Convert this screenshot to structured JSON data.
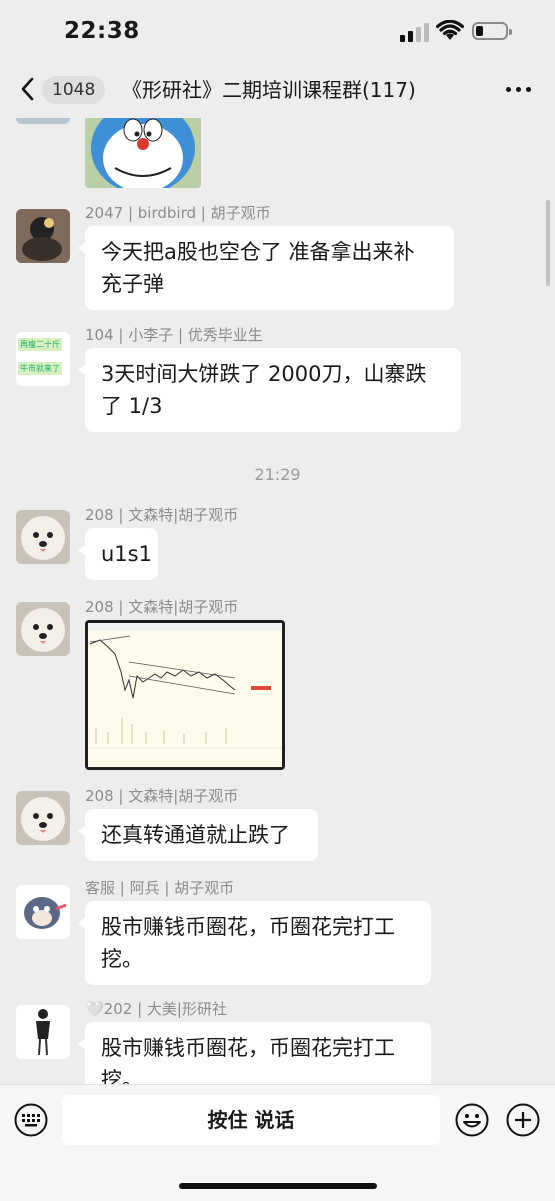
{
  "status_bar": {
    "time": "22:38"
  },
  "nav": {
    "unread_count": "1048",
    "title": "《形研社》二期培训课程群(117)"
  },
  "messages": [
    {
      "name": "2047 | birdbird | 胡子观币",
      "text": "今天把a股也空仓了 准备拿出来补充子弹",
      "line1": "今天把a股也空仓了 准备拿出来补",
      "line2": "充子弹"
    },
    {
      "name": "104 | 小李子 | 优秀毕业生",
      "line1": "3天时间大饼跌了 2000刀，山寨跌",
      "line2": "了 1/3",
      "avatar_label1": "再瘦二十斤",
      "avatar_label2": "牛市就来了"
    },
    {
      "timestamp": "21:29"
    },
    {
      "name": "208 | 文森特|胡子观币",
      "text": "u1s1"
    },
    {
      "name": "208 | 文森特|胡子观币",
      "type": "image-chart"
    },
    {
      "name": "208 | 文森特|胡子观币",
      "text": "还真转通道就止跌了"
    },
    {
      "name": "客服 | 阿兵 | 胡子观币",
      "line1": "股市赚钱币圈花，币圈花完打工",
      "line2": "挖。"
    },
    {
      "name": "🤍202 | 大美|形研社",
      "line1": "股市赚钱币圈花，币圈花完打工",
      "line2": "挖。"
    }
  ],
  "input_bar": {
    "hold_to_talk": "按住 说话"
  },
  "colors": {
    "bg": "#ededed",
    "bubble": "#ffffff",
    "name": "#8c8c8c"
  }
}
